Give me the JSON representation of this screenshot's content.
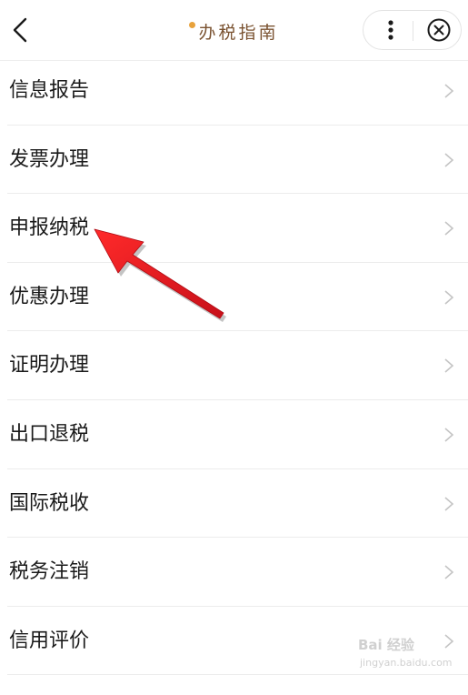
{
  "header": {
    "title": "办税指南",
    "back_icon": "chevron-left-icon",
    "more_icon": "more-vertical-icon",
    "close_icon": "close-circle-icon"
  },
  "menu": {
    "items": [
      {
        "label": "信息报告"
      },
      {
        "label": "发票办理"
      },
      {
        "label": "申报纳税"
      },
      {
        "label": "优惠办理"
      },
      {
        "label": "证明办理"
      },
      {
        "label": "出口退税"
      },
      {
        "label": "国际税收"
      },
      {
        "label": "税务注销"
      },
      {
        "label": "信用评价"
      }
    ],
    "chevron_icon": "chevron-right-icon"
  },
  "annotation": {
    "arrow_color": "#e8141c",
    "points_to": "申报纳税"
  },
  "watermark": {
    "text": "Bai 经验",
    "sub": "jingyan.baidu.com"
  },
  "colors": {
    "title": "#7a5230",
    "text": "#1a1a1a",
    "chevron": "#c4c4c4",
    "divider": "#ececec"
  }
}
